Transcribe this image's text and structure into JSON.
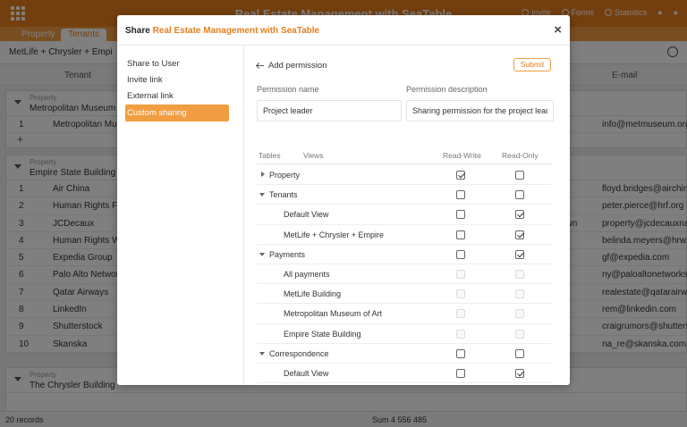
{
  "app": {
    "title": "Real Estate Management with SeaTable",
    "top_actions": [
      "Invite",
      "Forms",
      "Statistics"
    ]
  },
  "tabs": [
    "Property",
    "Tenants"
  ],
  "view": {
    "name": "MetLife + Chrysler + Empi"
  },
  "grid_header": {
    "tenant": "Tenant",
    "email": "E-mail"
  },
  "groups": [
    {
      "label": "Property",
      "value": "Metropolitan Museum of Art",
      "rows": [
        {
          "idx": "1",
          "tenant": "Metropolitan Muse",
          "email": "info@metmuseum.org"
        }
      ]
    },
    {
      "label": "Property",
      "value": "Empire State Building",
      "rows": [
        {
          "idx": "1",
          "tenant": "Air China",
          "email": "floyd.bridges@airchina"
        },
        {
          "idx": "2",
          "tenant": "Human Rights Four",
          "email": "peter.pierce@hrf.org"
        },
        {
          "idx": "3",
          "tenant": "JCDecaux",
          "mid": "own",
          "email": "property@jcdecauxna.c"
        },
        {
          "idx": "4",
          "tenant": "Human Rights Watc",
          "email": "belinda.meyers@hrw.o"
        },
        {
          "idx": "5",
          "tenant": "Expedia Group",
          "email": "gf@expedia.com"
        },
        {
          "idx": "6",
          "tenant": "Palo Alto Networks",
          "email": "ny@paloaltonetworks.c"
        },
        {
          "idx": "7",
          "tenant": "Qatar Airways",
          "email": "realestate@qatarairway"
        },
        {
          "idx": "8",
          "tenant": "LinkedIn",
          "email": "rem@linkedin.com"
        },
        {
          "idx": "9",
          "tenant": "Shutterstock",
          "email": "craigrumors@shutterst"
        },
        {
          "idx": "10",
          "tenant": "Skanska",
          "email": "na_re@skanska.com"
        }
      ]
    },
    {
      "label": "Property",
      "value": "The Chrysler Building",
      "rows": []
    }
  ],
  "status": {
    "records": "20 records",
    "sum": "Sum 4 556 485"
  },
  "modal": {
    "title_prefix": "Share",
    "title_base": "Real Estate Management with SeaTable",
    "close": "×",
    "sidebar": [
      {
        "label": "Share to User",
        "active": false
      },
      {
        "label": "Invite link",
        "active": false
      },
      {
        "label": "External link",
        "active": false
      },
      {
        "label": "Custom sharing permissions",
        "active": true
      }
    ],
    "back_label": "Add permission",
    "submit_label": "Submit",
    "name_label": "Permission name",
    "name_value": "Project leader",
    "desc_label": "Permission description",
    "desc_value": "Sharing permission for the project leaders.",
    "table_headers": {
      "tables": "Tables",
      "views": "Views",
      "rw": "Read-Write",
      "ro": "Read-Only"
    },
    "permissions": [
      {
        "label": "Property",
        "level": "table",
        "caret": "right",
        "rw": true,
        "ro": false,
        "disabled": false
      },
      {
        "label": "Tenants",
        "level": "table",
        "caret": "down",
        "rw": false,
        "ro": false,
        "disabled": false
      },
      {
        "label": "Default View",
        "level": "view",
        "rw": false,
        "ro": true,
        "disabled": false
      },
      {
        "label": "MetLife + Chrysler + Empire",
        "level": "view",
        "rw": false,
        "ro": true,
        "disabled": false
      },
      {
        "label": "Payments",
        "level": "table",
        "caret": "down",
        "rw": false,
        "ro": true,
        "disabled": false
      },
      {
        "label": "All payments",
        "level": "view",
        "rw": false,
        "ro": false,
        "disabled": true
      },
      {
        "label": "MetLife Building",
        "level": "view",
        "rw": false,
        "ro": false,
        "disabled": true
      },
      {
        "label": "Metropolitan Museum of Art",
        "level": "view",
        "rw": false,
        "ro": false,
        "disabled": true
      },
      {
        "label": "Empire State Building",
        "level": "view",
        "rw": false,
        "ro": false,
        "disabled": true
      },
      {
        "label": "Correspondence",
        "level": "table",
        "caret": "down",
        "rw": false,
        "ro": false,
        "disabled": false
      },
      {
        "label": "Default View",
        "level": "view",
        "rw": false,
        "ro": true,
        "disabled": false
      }
    ]
  }
}
